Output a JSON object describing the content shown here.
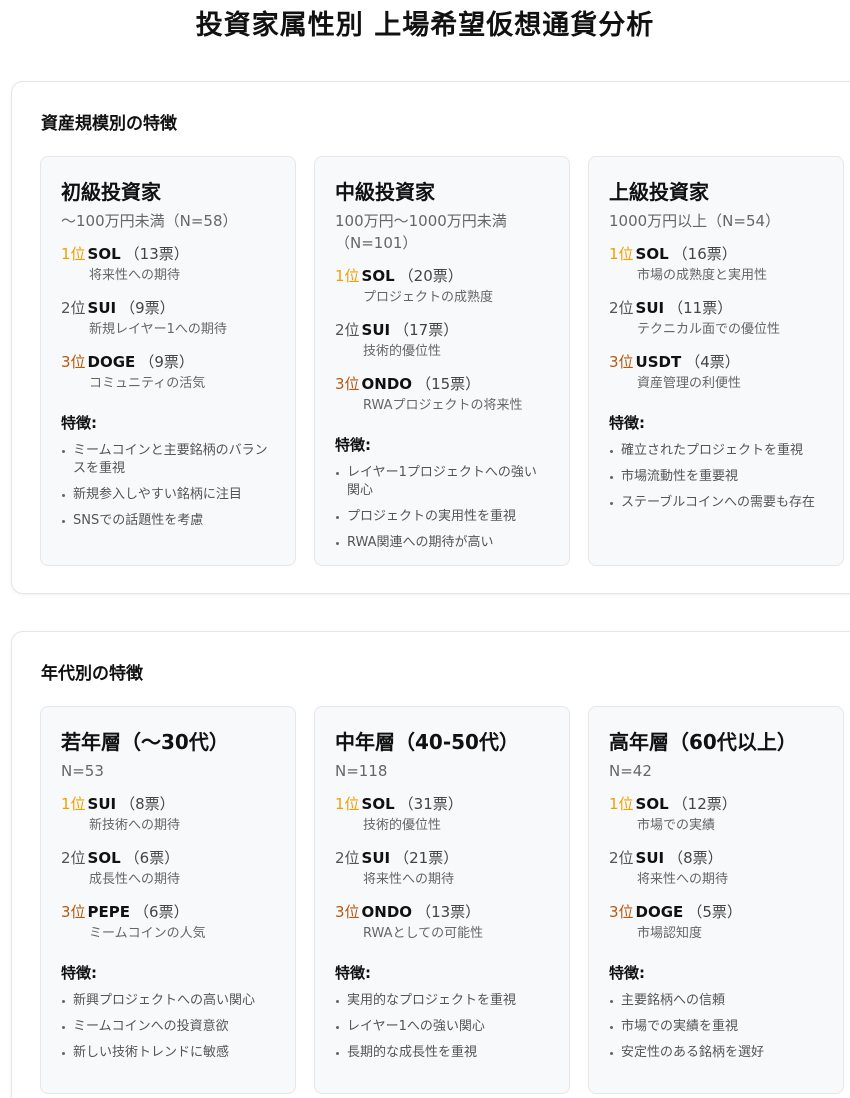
{
  "page_title": "投資家属性別 上場希望仮想通貨分析",
  "sections": [
    {
      "heading": "資産規模別の特徴",
      "cards": [
        {
          "title": "初級投資家",
          "subtitle": "～100万円未満（N=58）",
          "ranks": [
            {
              "pos": "1位",
              "coin": "SOL",
              "votes": "（13票）",
              "note": "将来性への期待"
            },
            {
              "pos": "2位",
              "coin": "SUI",
              "votes": "（9票）",
              "note": "新規レイヤー1への期待"
            },
            {
              "pos": "3位",
              "coin": "DOGE",
              "votes": "（9票）",
              "note": "コミュニティの活気"
            }
          ],
          "features_label": "特徴:",
          "features": [
            "ミームコインと主要銘柄のバランスを重視",
            "新規参入しやすい銘柄に注目",
            "SNSでの話題性を考慮"
          ]
        },
        {
          "title": "中級投資家",
          "subtitle": "100万円～1000万円未満（N=101）",
          "ranks": [
            {
              "pos": "1位",
              "coin": "SOL",
              "votes": "（20票）",
              "note": "プロジェクトの成熟度"
            },
            {
              "pos": "2位",
              "coin": "SUI",
              "votes": "（17票）",
              "note": "技術的優位性"
            },
            {
              "pos": "3位",
              "coin": "ONDO",
              "votes": "（15票）",
              "note": "RWAプロジェクトの将来性"
            }
          ],
          "features_label": "特徴:",
          "features": [
            "レイヤー1プロジェクトへの強い関心",
            "プロジェクトの実用性を重視",
            "RWA関連への期待が高い"
          ]
        },
        {
          "title": "上級投資家",
          "subtitle": "1000万円以上（N=54）",
          "ranks": [
            {
              "pos": "1位",
              "coin": "SOL",
              "votes": "（16票）",
              "note": "市場の成熟度と実用性"
            },
            {
              "pos": "2位",
              "coin": "SUI",
              "votes": "（11票）",
              "note": "テクニカル面での優位性"
            },
            {
              "pos": "3位",
              "coin": "USDT",
              "votes": "（4票）",
              "note": "資産管理の利便性"
            }
          ],
          "features_label": "特徴:",
          "features": [
            "確立されたプロジェクトを重視",
            "市場流動性を重要視",
            "ステーブルコインへの需要も存在"
          ]
        }
      ]
    },
    {
      "heading": "年代別の特徴",
      "cards": [
        {
          "title": "若年層（～30代）",
          "subtitle": "N=53",
          "ranks": [
            {
              "pos": "1位",
              "coin": "SUI",
              "votes": "（8票）",
              "note": "新技術への期待"
            },
            {
              "pos": "2位",
              "coin": "SOL",
              "votes": "（6票）",
              "note": "成長性への期待"
            },
            {
              "pos": "3位",
              "coin": "PEPE",
              "votes": "（6票）",
              "note": "ミームコインの人気"
            }
          ],
          "features_label": "特徴:",
          "features": [
            "新興プロジェクトへの高い関心",
            "ミームコインへの投資意欲",
            "新しい技術トレンドに敏感"
          ]
        },
        {
          "title": "中年層（40-50代）",
          "subtitle": "N=118",
          "ranks": [
            {
              "pos": "1位",
              "coin": "SOL",
              "votes": "（31票）",
              "note": "技術的優位性"
            },
            {
              "pos": "2位",
              "coin": "SUI",
              "votes": "（21票）",
              "note": "将来性への期待"
            },
            {
              "pos": "3位",
              "coin": "ONDO",
              "votes": "（13票）",
              "note": "RWAとしての可能性"
            }
          ],
          "features_label": "特徴:",
          "features": [
            "実用的なプロジェクトを重視",
            "レイヤー1への強い関心",
            "長期的な成長性を重視"
          ]
        },
        {
          "title": "高年層（60代以上）",
          "subtitle": "N=42",
          "ranks": [
            {
              "pos": "1位",
              "coin": "SOL",
              "votes": "（12票）",
              "note": "市場での実績"
            },
            {
              "pos": "2位",
              "coin": "SUI",
              "votes": "（8票）",
              "note": "将来性への期待"
            },
            {
              "pos": "3位",
              "coin": "DOGE",
              "votes": "（5票）",
              "note": "市場認知度"
            }
          ],
          "features_label": "特徴:",
          "features": [
            "主要銘柄への信頼",
            "市場での実績を重視",
            "安定性のある銘柄を選好"
          ]
        }
      ]
    }
  ]
}
